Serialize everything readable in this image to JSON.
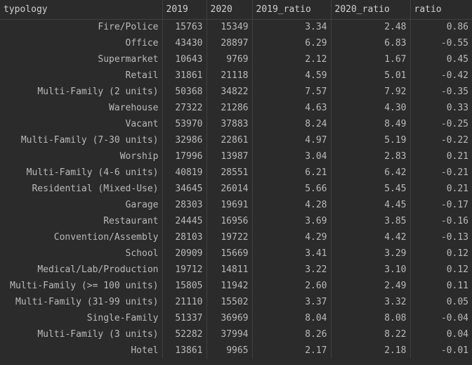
{
  "table": {
    "columns": [
      "typology",
      "2019",
      "2020",
      "2019_ratio",
      "2020_ratio",
      "ratio"
    ],
    "rows": [
      [
        "Fire/Police",
        "15763",
        "15349",
        "3.34",
        "2.48",
        "0.86"
      ],
      [
        "Office",
        "43430",
        "28897",
        "6.29",
        "6.83",
        "-0.55"
      ],
      [
        "Supermarket",
        "10643",
        "9769",
        "2.12",
        "1.67",
        "0.45"
      ],
      [
        "Retail",
        "31861",
        "21118",
        "4.59",
        "5.01",
        "-0.42"
      ],
      [
        "Multi-Family (2 units)",
        "50368",
        "34822",
        "7.57",
        "7.92",
        "-0.35"
      ],
      [
        "Warehouse",
        "27322",
        "21286",
        "4.63",
        "4.30",
        "0.33"
      ],
      [
        "Vacant",
        "53970",
        "37883",
        "8.24",
        "8.49",
        "-0.25"
      ],
      [
        "Multi-Family (7-30 units)",
        "32986",
        "22861",
        "4.97",
        "5.19",
        "-0.22"
      ],
      [
        "Worship",
        "17996",
        "13987",
        "3.04",
        "2.83",
        "0.21"
      ],
      [
        "Multi-Family (4-6 units)",
        "40819",
        "28551",
        "6.21",
        "6.42",
        "-0.21"
      ],
      [
        "Residential (Mixed-Use)",
        "34645",
        "26014",
        "5.66",
        "5.45",
        "0.21"
      ],
      [
        "Garage",
        "28303",
        "19691",
        "4.28",
        "4.45",
        "-0.17"
      ],
      [
        "Restaurant",
        "24445",
        "16956",
        "3.69",
        "3.85",
        "-0.16"
      ],
      [
        "Convention/Assembly",
        "28103",
        "19722",
        "4.29",
        "4.42",
        "-0.13"
      ],
      [
        "School",
        "20909",
        "15669",
        "3.41",
        "3.29",
        "0.12"
      ],
      [
        "Medical/Lab/Production",
        "19712",
        "14811",
        "3.22",
        "3.10",
        "0.12"
      ],
      [
        "Multi-Family (>= 100 units)",
        "15805",
        "11942",
        "2.60",
        "2.49",
        "0.11"
      ],
      [
        "Multi-Family (31-99 units)",
        "21110",
        "15502",
        "3.37",
        "3.32",
        "0.05"
      ],
      [
        "Single-Family",
        "51337",
        "36969",
        "8.04",
        "8.08",
        "-0.04"
      ],
      [
        "Multi-Family (3 units)",
        "52282",
        "37994",
        "8.26",
        "8.22",
        "0.04"
      ],
      [
        "Hotel",
        "13861",
        "9965",
        "2.17",
        "2.18",
        "-0.01"
      ]
    ]
  },
  "colors": {
    "background": "#2b2b2b",
    "text": "#bababa",
    "grid": "#3e4043"
  }
}
